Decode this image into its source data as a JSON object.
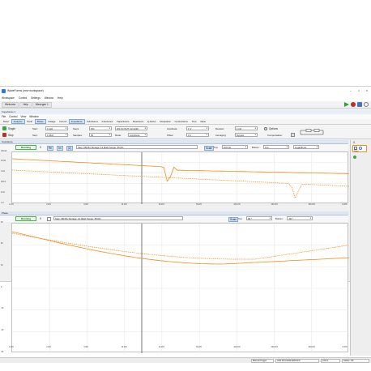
{
  "window": {
    "title": "WaveForms (new workspace)",
    "controls": [
      "–",
      "□",
      "✕"
    ]
  },
  "menu": [
    "Workspace",
    "Control",
    "Settings",
    "Window",
    "Help"
  ],
  "workspace_tabs": [
    "Welcome",
    "Help",
    "Wavegen 1",
    "Impedance 1"
  ],
  "instrument": {
    "title": "Impedance 1",
    "menu": [
      "File",
      "Control",
      "View",
      "Window"
    ],
    "view_tabs": [
      "Meter",
      "Analyzer",
      "Smith",
      "Phase",
      "Voltage",
      "Current",
      "Impedance",
      "Admittance",
      "Inductance",
      "Capacitance",
      "Reactance",
      "Q-Factor",
      "Dissipation",
      "Conductance",
      "Time",
      "Value"
    ],
    "single_label": "Single",
    "stop_label": "Stop",
    "start_label": "Start:",
    "start_value": "1 kHz",
    "stop_freq_label": "Stop:",
    "stop_value": "1 MHz",
    "steps_label": "Steps:",
    "steps_value": "151",
    "samples_label": "Samples:",
    "samples_value": "50",
    "mode_label": "Mode:",
    "mode_value": "Amplitude",
    "adapter_value": "W1-C1 DUT C2-GND",
    "amplitude_label": "Amplitude:",
    "amplitude_value": "1 V",
    "offset_label": "Offset:",
    "offset_value": "0 V",
    "resistor_label": "Resistor:",
    "resistor_value": "1 kΩ",
    "averaging_label": "Averaging:",
    "averaging_value": "Nyquist",
    "options_label": "Options",
    "compensation_label": "Compensation:"
  },
  "impedance_panel": {
    "title": "Impedance",
    "running_label": "Running",
    "x_label": "X",
    "buttons": [
      "Re",
      "Im",
      "|Z|"
    ],
    "status_text": "Step: 68/151 Storage: 14.0kHz Scope: 35.0%",
    "scale_label": "Scale",
    "top_label": "Top:",
    "top_value": "100 kΩ",
    "bottom_label": "Bottom:",
    "bottom_value": "0 Ω",
    "log_value": "Logarithmic",
    "y_ticks": [
      "100 kΩ",
      "10 kΩ",
      "1 kΩ",
      "100 Ω",
      "10 Ω",
      "1 Ω"
    ],
    "x_ticks": [
      "1 kHz",
      "2 kHz",
      "5 kHz",
      "10 kHz",
      "20 kHz",
      "50 kHz",
      "100 kHz",
      "200 kHz",
      "500 kHz",
      "1 MHz"
    ]
  },
  "phase_panel": {
    "title": "Phase",
    "running_label": "Running",
    "x_label": "X",
    "status_text": "Step: 68/151 Storage: 14.0kHz Scope: 35.0%",
    "scale_label": "Scale",
    "top_label": "Top:",
    "top_value": "90 °",
    "bottom_label": "Bottom:",
    "bottom_value": "-90 °",
    "y_ticks": [
      "90",
      "60",
      "30",
      "0",
      "-30",
      "-60",
      "-90"
    ],
    "x_ticks": [
      "1 kHz",
      "2 kHz",
      "5 kHz",
      "10 kHz",
      "20 kHz",
      "50 kHz",
      "100 kHz",
      "200 kHz",
      "500 kHz",
      "1 MHz"
    ]
  },
  "side_panel": {
    "x_label": "X",
    "magnify_label": "Magn"
  },
  "status_bar": {
    "trigger": "Manual Trigger",
    "device": "AD2",
    "serial": "SN:210321A8C1FC",
    "version": "3.18.1",
    "status": "Status: OK"
  },
  "colors": {
    "trace": "#f28c18",
    "highlight": "#f28c18",
    "running": "#3ea83e",
    "panel_head": "#dde7f2"
  }
}
